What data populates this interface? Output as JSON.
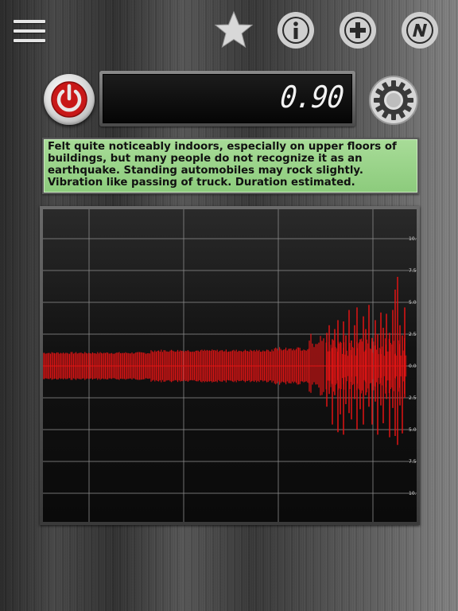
{
  "toolbar": {
    "menu_icon": "hamburger-menu-icon",
    "favorite_icon": "star-icon",
    "info_icon": "info-icon",
    "add_icon": "plus-icon",
    "app_icon": "brand-n-icon"
  },
  "controls": {
    "power_icon": "power-icon",
    "settings_icon": "gear-icon"
  },
  "display": {
    "value": "0.90"
  },
  "description": {
    "text": "Felt quite noticeably indoors, especially on upper floors of buildings, but many people do not recognize it as an earthquake. Standing automobiles may rock slightly. Vibration like passing of truck. Duration estimated."
  },
  "graph": {
    "y_tick_labels": [
      "10.0",
      "7.5",
      "5.0",
      "2.5",
      "0.0",
      "2.5",
      "5.0",
      "7.5",
      "10.0"
    ],
    "y_tick_values": [
      10,
      7.5,
      5,
      2.5,
      0,
      -2.5,
      -5,
      -7.5,
      -10
    ],
    "trace_color": "#e01414",
    "grid_color": "#8a8a8a"
  },
  "colors": {
    "description_bg": "#9fd68f",
    "power_red": "#c81818"
  }
}
